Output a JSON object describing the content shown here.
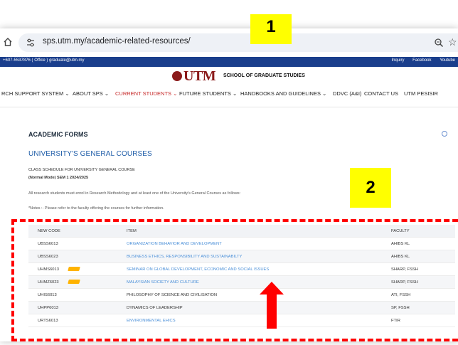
{
  "browser": {
    "url": "sps.utm.my/academic-related-resources/",
    "icons": [
      "home-icon",
      "site-settings-icon",
      "zoom-icon",
      "bookmark-star-icon"
    ]
  },
  "callouts": {
    "first": "1",
    "second": "2"
  },
  "topbar": {
    "contact": "+607-5537876 ( Office )   graduate@utm.my",
    "links": [
      "Inquiry",
      "Facebook",
      "Youtube"
    ]
  },
  "logo": {
    "text": "UTM",
    "school": "SCHOOL OF GRADUATE STUDIES"
  },
  "nav": {
    "items": [
      "RCH SUPPORT SYSTEM ⌄",
      "ABOUT SPS ⌄",
      "CURRENT STUDENTS ⌄",
      "FUTURE STUDENTS ⌄",
      "HANDBOOKS AND GUIDELINES ⌄",
      "DDVC (A&I)",
      "CONTACT US",
      "UTM PESISIR"
    ],
    "active_index": 2
  },
  "content": {
    "section_title": "ACADEMIC FORMS",
    "courses_title": "UNIVERSITY'S GENERAL COURSES",
    "schedule": "CLASS SCHEDULE FOR UNIVERSITY GENERAL COURSE",
    "mode": "(Normal Mode) SEM 1 2024/2025",
    "enrol": "All research students must enrol in Research Methodology and at least one of the University's General Courses as follows:",
    "notes": "*Notes :- Please refer to the faculty offering the courses for further information."
  },
  "table": {
    "headers": {
      "code": "NEW CODE",
      "item": "ITEM",
      "faculty": "FACULTY"
    },
    "rows": [
      {
        "code": "UBSS6013",
        "item": "ORGANIZATION BEHAVIOR AND DEVELOPMENT",
        "faculty": "AHIBS KL",
        "link": true,
        "new": false
      },
      {
        "code": "UBSS6023",
        "item": "BUSINESS ETHICS, RESPONSIBILITY AND SUSTAINABILTY",
        "faculty": "AHIBS KL",
        "link": true,
        "new": false
      },
      {
        "code": "UHMS6013",
        "item": "SEMINAR ON GLOBAL DEVELOPMENT, ECONOMIC AND SOCIAL ISSUES",
        "faculty": "SHARP, FSSH",
        "link": true,
        "new": true
      },
      {
        "code": "UHMZ6023",
        "item": "MALAYSIAN SOCIETY AND CULTURE",
        "faculty": "SHARP, FSSH",
        "link": true,
        "new": true
      },
      {
        "code": "UHIS6013",
        "item": "PHILOSOPHY OF SCIENCE AND CIVILISATION",
        "faculty": "ATI, FSSH",
        "link": false,
        "new": false
      },
      {
        "code": "UHPP6013",
        "item": "DYNAMICS OF LEADERSHIP",
        "faculty": "SP, FSSH",
        "link": false,
        "new": false
      },
      {
        "code": "URTS6013",
        "item": "ENVIRONMENTAL EHICS",
        "faculty": "FTIR",
        "link": true,
        "new": false
      }
    ]
  },
  "colors": {
    "topbar": "#1a3e8c",
    "active_nav": "#c62828",
    "link": "#4a8fd8",
    "callout": "#ffff00",
    "highlight": "#ff0000"
  }
}
